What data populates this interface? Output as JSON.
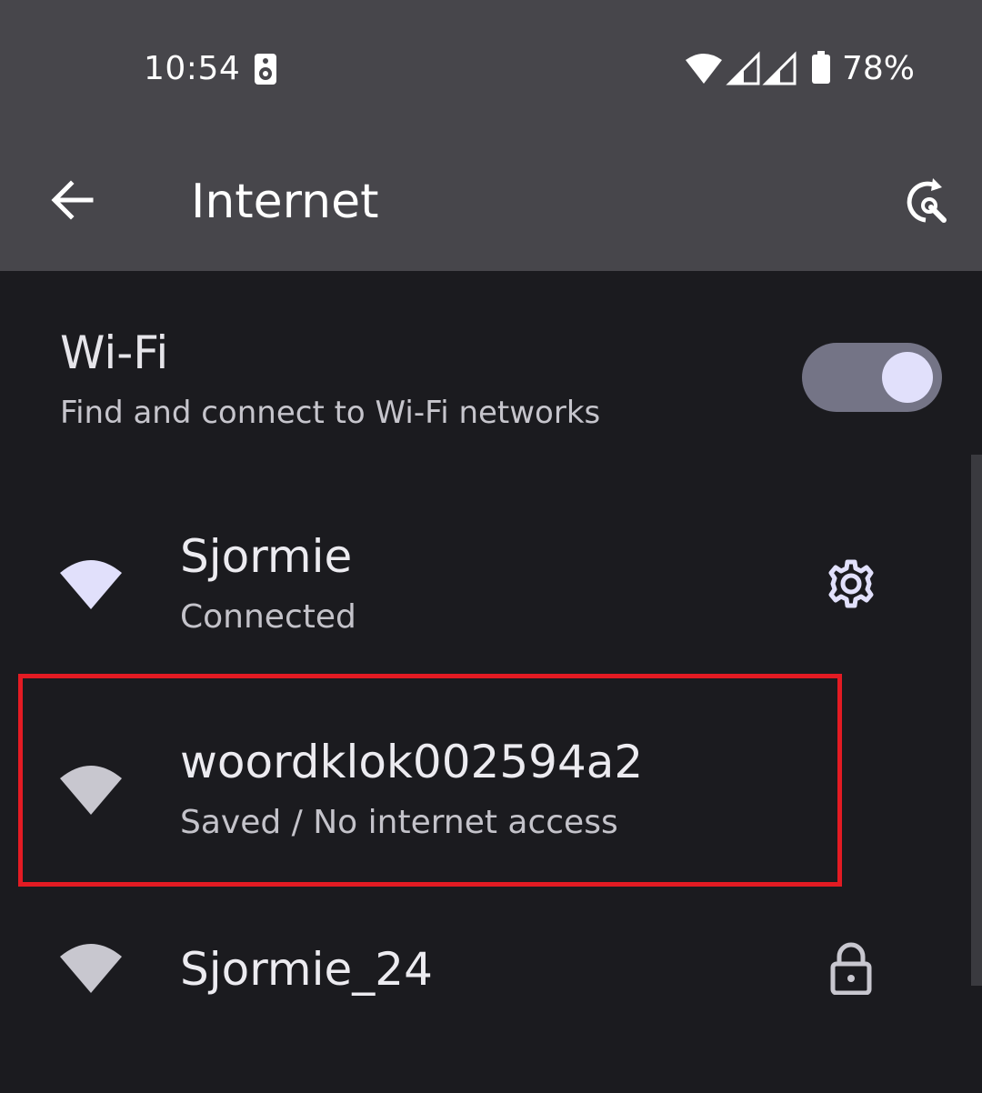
{
  "status_bar": {
    "time": "10:54",
    "battery_percent": "78%",
    "icons": [
      "speaker-icon",
      "wifi-signal-icon",
      "cell-signal-icon",
      "cell-signal-icon",
      "battery-icon"
    ]
  },
  "app_bar": {
    "title": "Internet",
    "back_icon": "arrow-back-icon",
    "action_icon": "network-reset-icon"
  },
  "wifi": {
    "title": "Wi-Fi",
    "subtitle": "Find and connect to Wi-Fi networks",
    "enabled": true
  },
  "networks": [
    {
      "name": "Sjormie",
      "status": "Connected",
      "icon": "wifi-full-icon",
      "action_icon": "gear-icon",
      "icon_color": "#e1e0fb"
    },
    {
      "name": "woordklok002594a2",
      "status": "Saved / No internet access",
      "icon": "wifi-full-icon",
      "action_icon": "",
      "icon_color": "#c8c7cf",
      "highlighted": true
    },
    {
      "name": "Sjormie_24",
      "status": "",
      "icon": "wifi-full-icon",
      "action_icon": "lock-icon",
      "icon_color": "#c8c7cf"
    }
  ],
  "colors": {
    "header_bg": "#47464b",
    "body_bg": "#1b1b1f",
    "highlight": "#e31b23",
    "toggle_track": "#747486",
    "toggle_thumb": "#e1e0fb"
  }
}
